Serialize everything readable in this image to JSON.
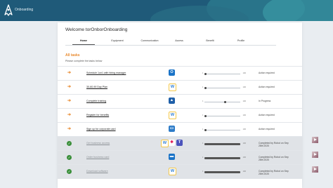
{
  "header": {
    "app_title": "Onboarding"
  },
  "welcome": "Welcome torOnborOnboarding",
  "tabs": [
    {
      "label": "Home",
      "active": true
    },
    {
      "label": "Equipment",
      "active": false
    },
    {
      "label": "Communication",
      "active": false
    },
    {
      "label": "Access",
      "active": false
    },
    {
      "label": "Benefit",
      "active": false
    },
    {
      "label": "Profile",
      "active": false
    }
  ],
  "section": {
    "title": "All tasks",
    "instruction": "Please complete the tasks below"
  },
  "tasks": [
    {
      "name": "Schedule 1on1 with hiring manager",
      "icons": [
        "outlook-icon"
      ],
      "progress_min": "1",
      "progress_max": "100",
      "progress": 0.05,
      "status": "Action required",
      "done": false
    },
    {
      "name": "30-60-90 Day Plan",
      "icons": [
        "word-icon"
      ],
      "progress_min": "1",
      "progress_max": "100",
      "progress": 0.05,
      "status": "Action required",
      "done": false
    },
    {
      "name": "Complete training",
      "icons": [
        "learning-icon"
      ],
      "progress_min": "1",
      "progress_max": "100",
      "progress": 0.55,
      "status": "In Progress",
      "done": false
    },
    {
      "name": "Register for benefits",
      "icons": [
        "word-icon"
      ],
      "progress_min": "1",
      "progress_max": "100",
      "progress": 0.05,
      "status": "Action required",
      "done": false
    },
    {
      "name": "Sign up for corporate card",
      "icons": [
        "card-icon"
      ],
      "progress_min": "1",
      "progress_max": "100",
      "progress": 0.05,
      "status": "Action required",
      "done": false
    },
    {
      "name": "Get business access",
      "icons": [
        "word-icon",
        "slack-icon",
        "teams-icon"
      ],
      "progress_min": "1",
      "progress_max": "100",
      "progress": 1.0,
      "status": "Completed by Robot on Sep 28th 2020",
      "done": true
    },
    {
      "name": "Order business card",
      "icons": [
        "laptop-icon"
      ],
      "progress_min": "1",
      "progress_max": "100",
      "progress": 1.0,
      "status": "Completed by Robot on Sep 28th 2020",
      "done": true
    },
    {
      "name": "Download software",
      "icons": [
        "word-icon"
      ],
      "progress_min": "1",
      "progress_max": "100",
      "progress": 1.0,
      "status": "Completed by Robot on Sep 28th 2020",
      "done": true
    }
  ],
  "colors": {
    "header": "#1f5a79",
    "accent": "#e8892d",
    "done": "#3a8f3a"
  }
}
